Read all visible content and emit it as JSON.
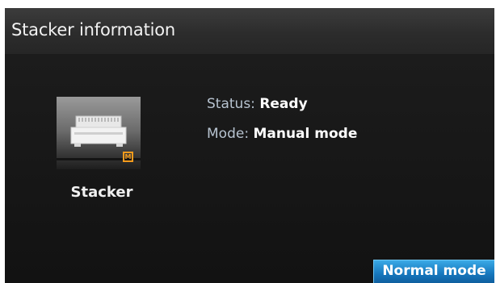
{
  "window": {
    "title": "Stacker information"
  },
  "device": {
    "label": "Stacker",
    "icon": "stacker-icon",
    "mode_badge": "M",
    "mode_badge_color": "#f49b1c"
  },
  "info": {
    "status_label": "Status:",
    "status_value": "Ready",
    "mode_label": "Mode:",
    "mode_value": "Manual mode"
  },
  "actions": {
    "normal_mode_label": "Normal mode",
    "accent_color": "#1677bd"
  }
}
